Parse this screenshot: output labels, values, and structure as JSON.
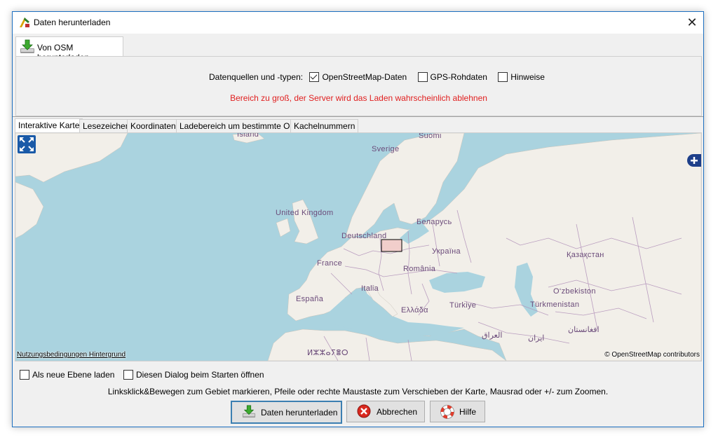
{
  "window": {
    "title": "Daten herunterladen",
    "close_symbol": "✕"
  },
  "top_tab": {
    "label": "Von OSM herunterladen",
    "icon": "download-icon"
  },
  "sources": {
    "label": "Datenquellen und -typen:",
    "items": [
      {
        "label": "OpenStreetMap-Daten",
        "checked": true
      },
      {
        "label": "GPS-Rohdaten",
        "checked": false
      },
      {
        "label": "Hinweise",
        "checked": false
      }
    ]
  },
  "warning": "Bereich zu groß, der Server wird das Laden wahrscheinlich ablehnen",
  "map_tabs": [
    "Interaktive Karte",
    "Lesezeichen",
    "Koordinaten",
    "Ladebereich um bestimmte Orte",
    "Kachelnummern"
  ],
  "map": {
    "labels": {
      "island": "Ísland",
      "sverige": "Sverige",
      "suomi": "Suomi",
      "uk": "United Kingdom",
      "belarus": "Беларусь",
      "deutschland": "Deutschland",
      "ukraina": "Україна",
      "kazakhstan": "Қазақстан",
      "france": "France",
      "romania": "România",
      "italia": "Italia",
      "uzbekiston": "O‘zbekiston",
      "espana": "España",
      "turkiye": "Türkiye",
      "turkmenistan": "Türkmenistan",
      "ellada": "Ελλάδα",
      "iraq": "العراق",
      "iran": "ایران",
      "afghanistan": "افغانستان",
      "tifinagh": "ⵍⵣⵣⴰⵢⴻⵔ"
    },
    "attribution_left": "Nutzungsbedingungen Hintergrund",
    "attribution_right": "© OpenStreetMap contributors",
    "colors": {
      "water": "#aad3df",
      "land": "#f2efe9",
      "border": "#b08fb8",
      "selection": "#f0b8b8"
    }
  },
  "options": {
    "new_layer": "Als neue Ebene laden",
    "show_on_start": "Diesen Dialog beim Starten öffnen"
  },
  "hint": "Linksklick&Bewegen zum Gebiet markieren, Pfeile oder rechte Maustaste zum Verschieben der Karte, Mausrad oder +/- zum Zoomen.",
  "buttons": {
    "download": "Daten herunterladen",
    "cancel": "Abbrechen",
    "help": "Hilfe"
  }
}
